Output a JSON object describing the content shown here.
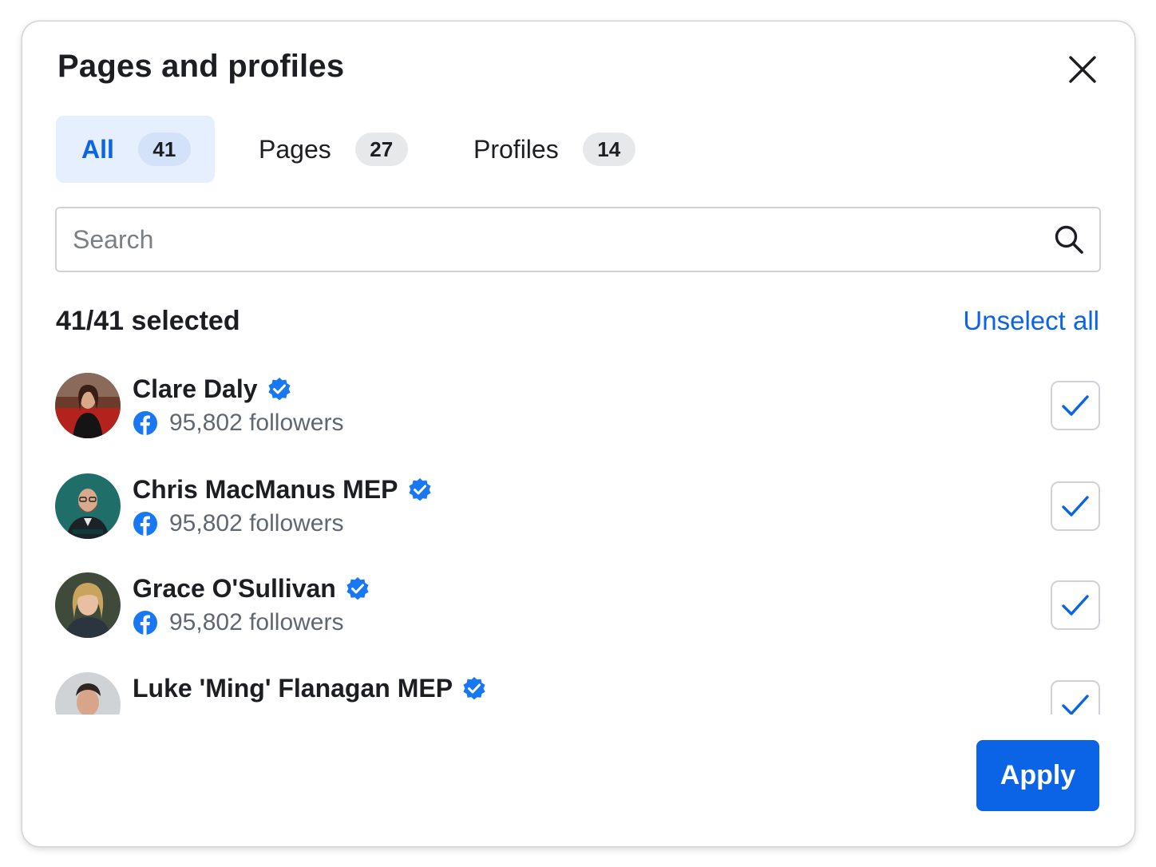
{
  "dialog": {
    "title": "Pages and profiles"
  },
  "tabs": [
    {
      "label": "All",
      "count": "41",
      "active": true
    },
    {
      "label": "Pages",
      "count": "27",
      "active": false
    },
    {
      "label": "Profiles",
      "count": "14",
      "active": false
    }
  ],
  "search": {
    "placeholder": "Search",
    "value": ""
  },
  "selection": {
    "summary": "41/41 selected",
    "unselect_label": "Unselect all"
  },
  "profiles": [
    {
      "name": "Clare Daly",
      "followers": "95,802 followers",
      "verified": true,
      "checked": true,
      "platform_icon": "facebook-icon"
    },
    {
      "name": "Chris MacManus MEP",
      "followers": "95,802 followers",
      "verified": true,
      "checked": true,
      "platform_icon": "facebook-icon"
    },
    {
      "name": "Grace O'Sullivan",
      "followers": "95,802 followers",
      "verified": true,
      "checked": true,
      "platform_icon": "facebook-icon"
    },
    {
      "name": "Luke 'Ming' Flanagan MEP",
      "followers": "",
      "verified": true,
      "checked": true,
      "platform_icon": "facebook-icon"
    }
  ],
  "footer": {
    "apply_label": "Apply"
  },
  "colors": {
    "accent": "#0b63e6",
    "active_tab_bg": "#e5effd",
    "verified_badge": "#1877f2",
    "text_primary": "#1c1e21",
    "text_secondary": "#606770"
  }
}
